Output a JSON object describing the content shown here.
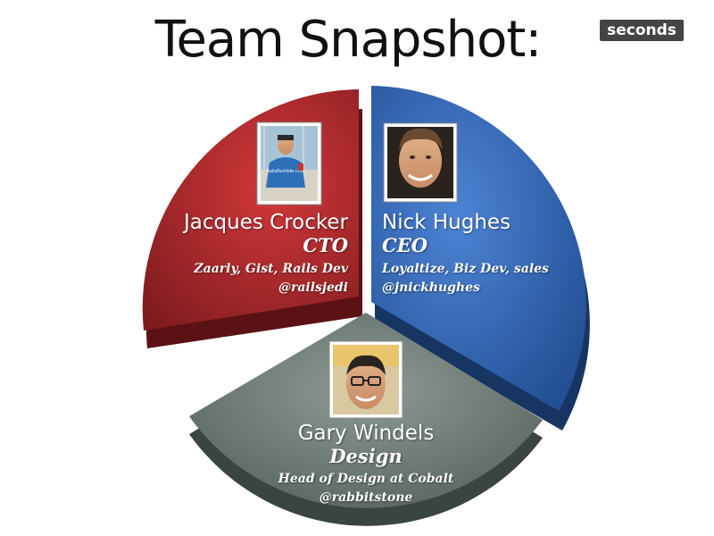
{
  "slide": {
    "title": "Team Snapshot:",
    "badge": "seconds"
  },
  "colors": {
    "cto_slice": "#a8262a",
    "ceo_slice": "#2f5fae",
    "design_slice": "#6a7a72"
  },
  "members": [
    {
      "name": "Jacques Crocker",
      "role": "CTO",
      "description": "Zaarly, Gist, Rails Dev",
      "handle": "@railsjedi",
      "photo_icon": "person-photo-icon",
      "shirt_text": "RailsRumble.com"
    },
    {
      "name": "Nick Hughes",
      "role": "CEO",
      "description": "Loyaltize, Biz Dev, sales",
      "handle": "@jnickhughes",
      "photo_icon": "person-photo-icon"
    },
    {
      "name": "Gary Windels",
      "role": "Design",
      "description": "Head of Design at Cobalt",
      "handle": "@rabbitstone",
      "photo_icon": "person-photo-icon"
    }
  ]
}
